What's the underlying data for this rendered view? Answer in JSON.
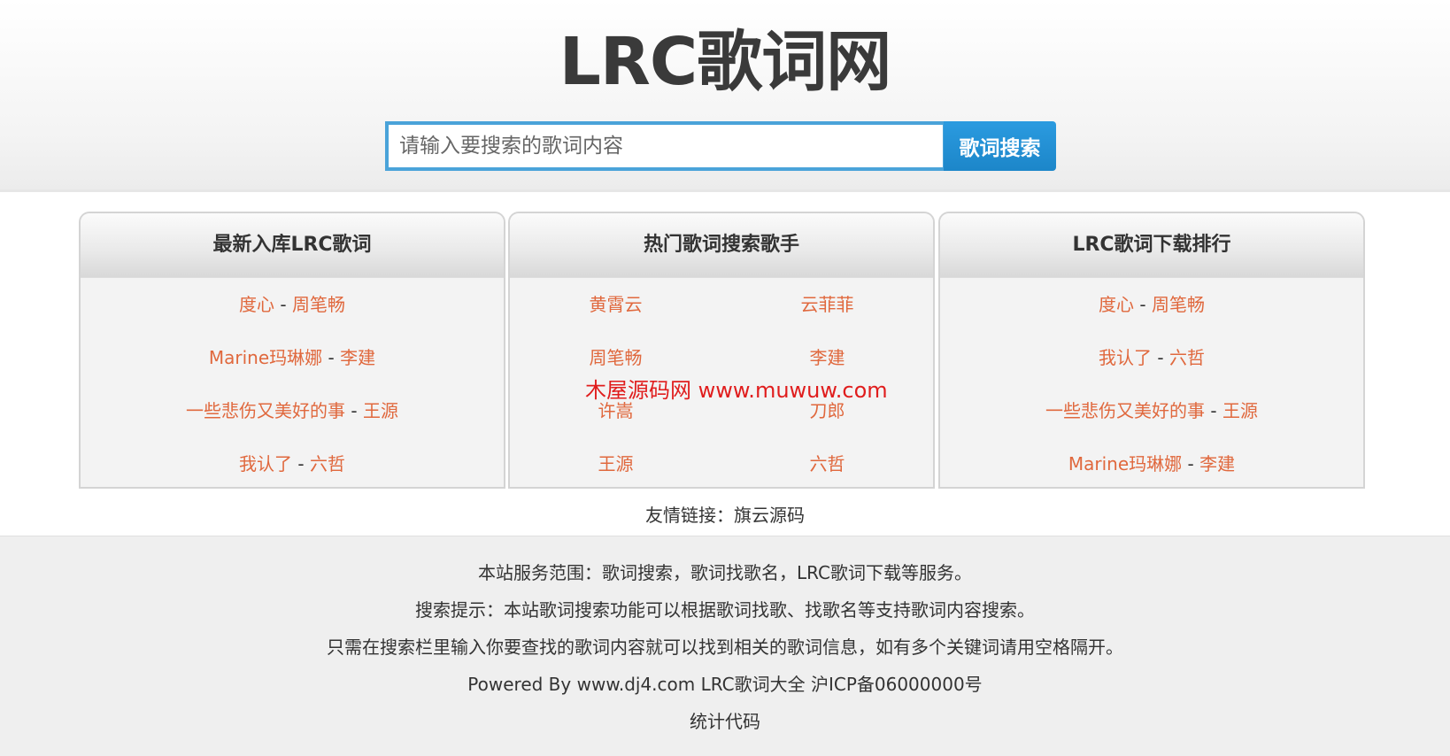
{
  "header": {
    "logo": "LRC歌词网",
    "search": {
      "placeholder": "请输入要搜索的歌词内容",
      "button_label": "歌词搜索"
    }
  },
  "panels": {
    "latest": {
      "title": "最新入库LRC歌词",
      "items": [
        {
          "song": "度心",
          "artist": "周笔畅"
        },
        {
          "song": "Marine玛琳娜",
          "artist": "李建"
        },
        {
          "song": "一些悲伤又美好的事",
          "artist": "王源"
        },
        {
          "song": "我认了",
          "artist": "六哲"
        }
      ],
      "separator": " - "
    },
    "hot_singers": {
      "title": "热门歌词搜索歌手",
      "singers": [
        "黄霄云",
        "云菲菲",
        "周笔畅",
        "李建",
        "许嵩",
        "刀郎",
        "王源",
        "六哲"
      ]
    },
    "top_downloads": {
      "title": "LRC歌词下载排行",
      "items": [
        {
          "song": "度心",
          "artist": "周笔畅"
        },
        {
          "song": "我认了",
          "artist": "六哲"
        },
        {
          "song": "一些悲伤又美好的事",
          "artist": "王源"
        },
        {
          "song": "Marine玛琳娜",
          "artist": "李建"
        }
      ],
      "separator": " - "
    }
  },
  "watermark": "木屋源码网 www.muwuw.com",
  "friend_links": {
    "label": "友情链接：",
    "link": "旗云源码"
  },
  "footer": {
    "lines": [
      "本站服务范围：歌词搜索，歌词找歌名，LRC歌词下载等服务。",
      "搜索提示：本站歌词搜索功能可以根据歌词找歌、找歌名等支持歌词内容搜索。",
      "只需在搜索栏里输入你要查找的歌词内容就可以找到相关的歌词信息，如有多个关键词请用空格隔开。",
      "Powered By www.dj4.com LRC歌词大全 沪ICP备06000000号",
      "统计代码"
    ]
  },
  "colors": {
    "link": "#e0683d",
    "accent": "#1c86c9",
    "watermark": "#e01d1d"
  }
}
